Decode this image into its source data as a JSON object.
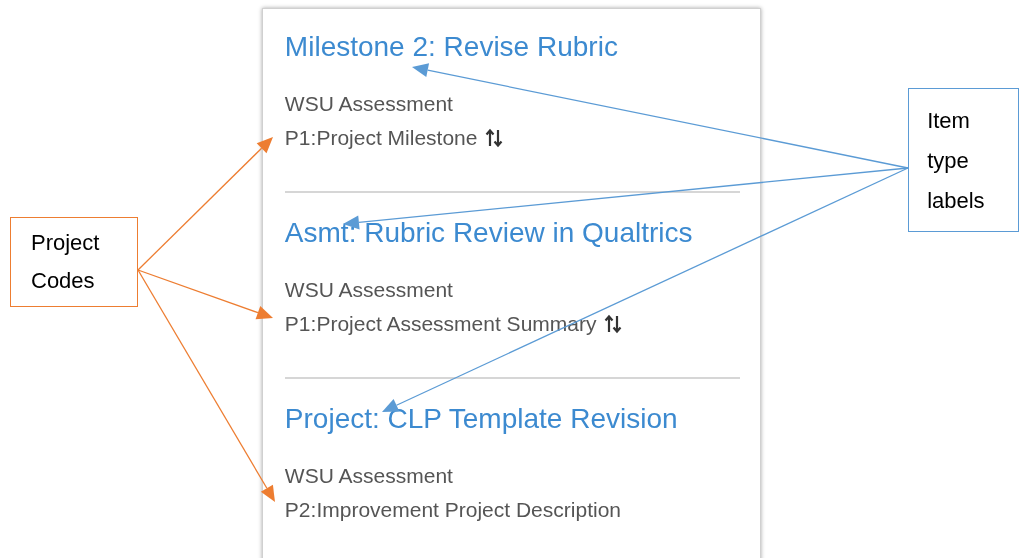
{
  "callouts": [
    {
      "lines": [
        "Project",
        "Codes"
      ],
      "color": "#ed7d31"
    },
    {
      "lines": [
        "Item",
        "type",
        "labels"
      ],
      "color": "#5b9bd5"
    }
  ],
  "items": [
    {
      "title": "Milestone 2: Revise Rubric",
      "organization": "WSU Assessment",
      "project_code": "P1:Project Milestone",
      "sortable": true
    },
    {
      "title": "Asmt: Rubric Review in Qualtrics",
      "organization": "WSU Assessment",
      "project_code": "P1:Project Assessment Summary",
      "sortable": true
    },
    {
      "title": "Project: CLP Template Revision",
      "organization": "WSU Assessment",
      "project_code": "P2:Improvement Project Description",
      "sortable": false
    }
  ]
}
